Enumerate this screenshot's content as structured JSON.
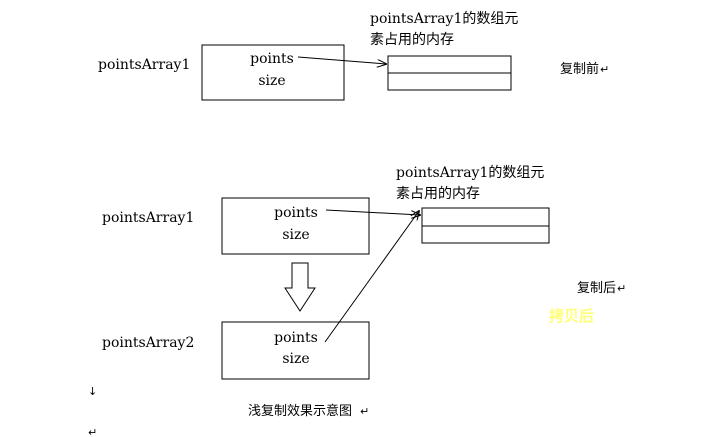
{
  "before": {
    "var_label": "pointsArray1",
    "field_points": "points",
    "field_size": "size",
    "memory_note_line1": "pointsArray1的数组元",
    "memory_note_line2": "素占用的内存",
    "state_label": "复制前"
  },
  "after": {
    "var1_label": "pointsArray1",
    "var2_label": "pointsArray2",
    "field_points": "points",
    "field_size": "size",
    "field_points2": "points",
    "field_size2": "size",
    "memory_note_line1": "pointsArray1的数组元",
    "memory_note_line2": "素占用的内存",
    "state_label": "复制后"
  },
  "watermark": {
    "text": "拷贝后",
    "color": "#ffff7a"
  },
  "caption": "浅复制效果示意图",
  "marks": {
    "para1": "↓",
    "para2": "↵",
    "para3": "↵",
    "para4": "↵"
  }
}
